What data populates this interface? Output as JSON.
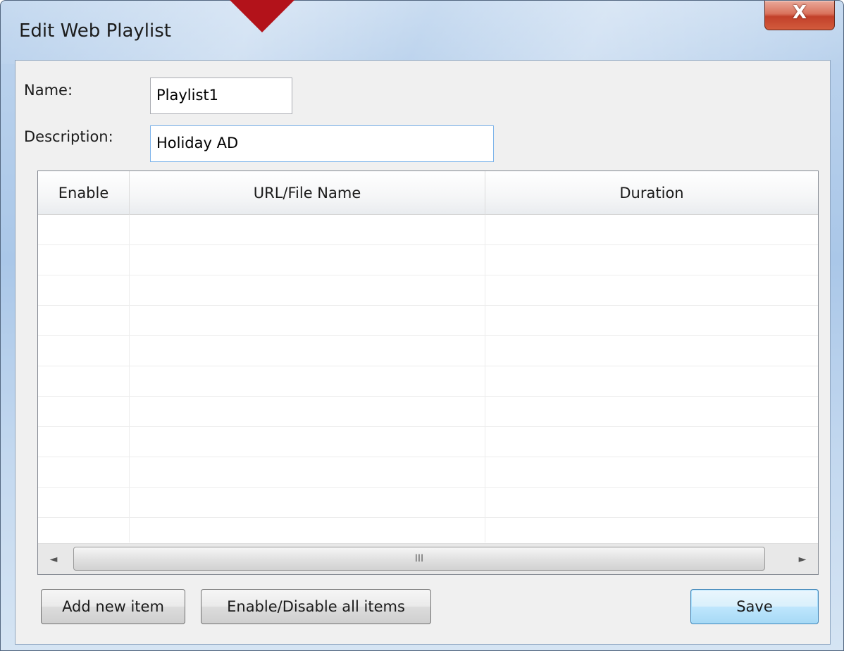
{
  "window": {
    "title": "Edit Web Playlist",
    "close_glyph": "X"
  },
  "form": {
    "name_label": "Name:",
    "name_value": "Playlist1",
    "description_label": "Description:",
    "description_value": "Holiday AD"
  },
  "grid": {
    "columns": [
      "Enable",
      "URL/File Name",
      "Duration"
    ],
    "rows": [],
    "scroll_left_glyph": "◄",
    "scroll_right_glyph": "►",
    "scroll_thumb_grip": "III"
  },
  "buttons": {
    "add_label": "Add new item",
    "toggle_label": "Enable/Disable all items",
    "save_label": "Save"
  },
  "colors": {
    "marker": "#b3121a",
    "close_button": "#c2402a"
  }
}
